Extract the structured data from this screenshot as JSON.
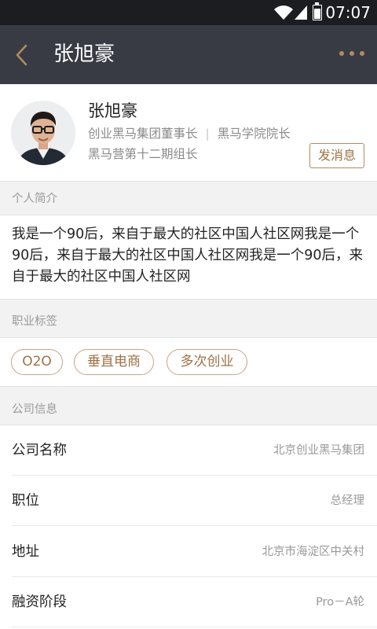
{
  "status_bar": {
    "time": "07:07",
    "battery_level": 0.7
  },
  "nav": {
    "title": "张旭豪"
  },
  "profile": {
    "name": "张旭豪",
    "title_part1": "创业黑马集团董事长",
    "separator": "|",
    "title_part2": "黑马学院院长",
    "title_line2": "黑马营第十二期组长",
    "message_button": "发消息"
  },
  "sections": {
    "intro_header": "个人简介",
    "intro_text": "我是一个90后，来自于最大的社区中国人社区网我是一个90后，来自于最大的社区中国人社区网我是一个90后，来自于最大的社区中国人社区网",
    "tags_header": "职业标签",
    "tags": [
      "O2O",
      "垂直电商",
      "多次创业"
    ],
    "company_header": "公司信息"
  },
  "company": [
    {
      "label": "公司名称",
      "value": "北京创业黑马集团"
    },
    {
      "label": "职位",
      "value": "总经理"
    },
    {
      "label": "地址",
      "value": "北京市海淀区中关村"
    },
    {
      "label": "融资阶段",
      "value": "Pro－A轮"
    }
  ],
  "colors": {
    "nav_bg": "#383b43",
    "accent": "#b58a5e",
    "status_bar_bg": "#1c1d21"
  }
}
